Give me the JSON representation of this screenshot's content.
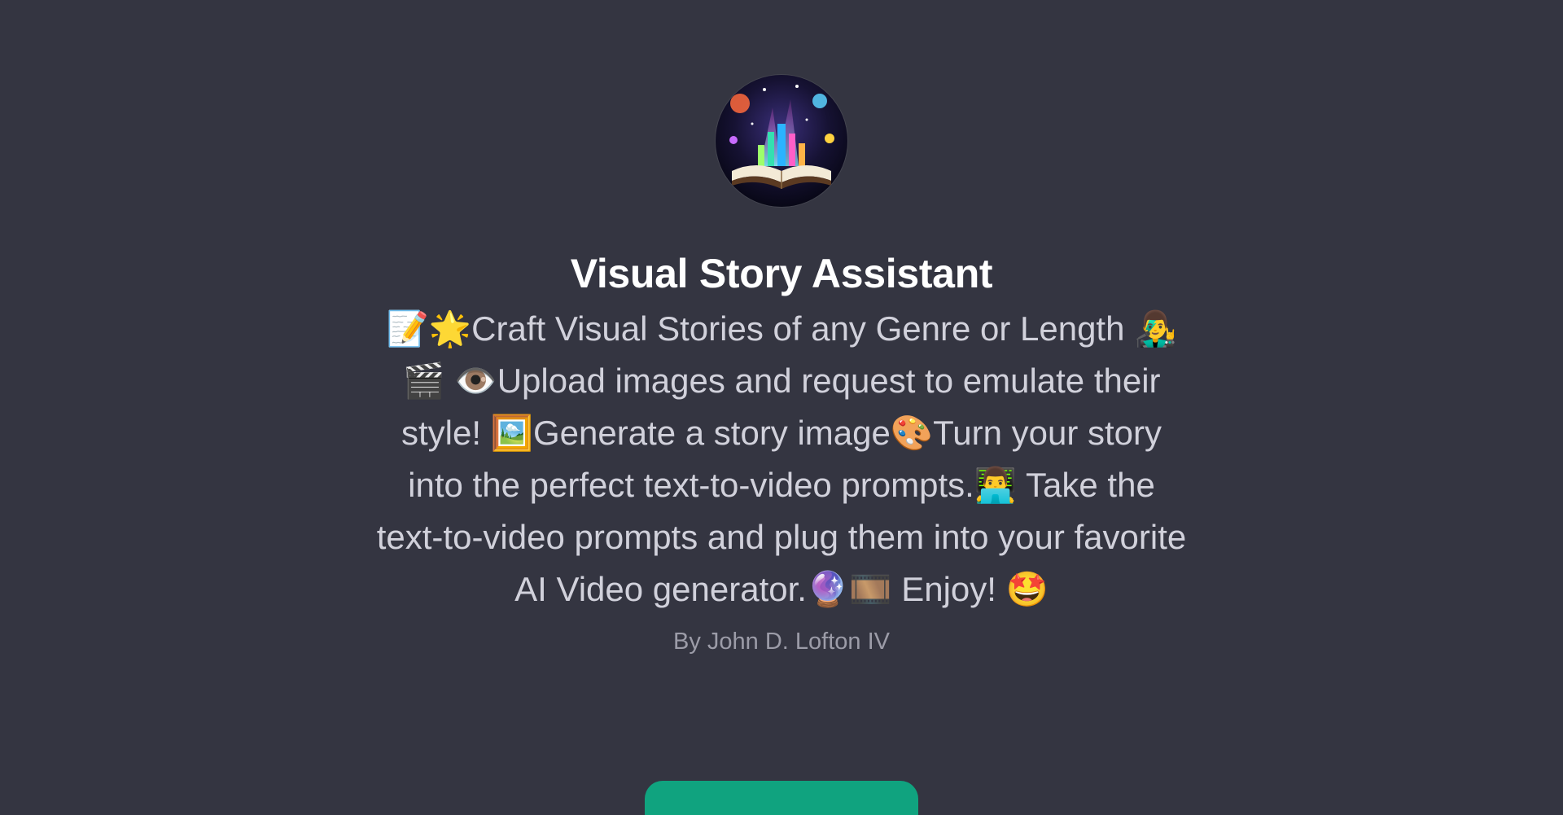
{
  "gpt": {
    "avatar_icon": "magical-story-book-avatar",
    "title": "Visual Story Assistant",
    "description": "📝🌟Craft Visual Stories of any Genre or Length 👨‍🎤🎬 👁️Upload images and request to emulate their style! 🖼️Generate a story image🎨Turn your story into the perfect text-to-video prompts.👨‍💻 Take the text-to-video prompts and plug them into your favorite AI Video generator.🔮🎞️ Enjoy! 🤩",
    "author": "By John D. Lofton IV"
  },
  "colors": {
    "background": "#343541",
    "title": "#ffffff",
    "description": "#d1d1db",
    "author": "#9c9ca8",
    "accent_button": "#10a37f"
  }
}
